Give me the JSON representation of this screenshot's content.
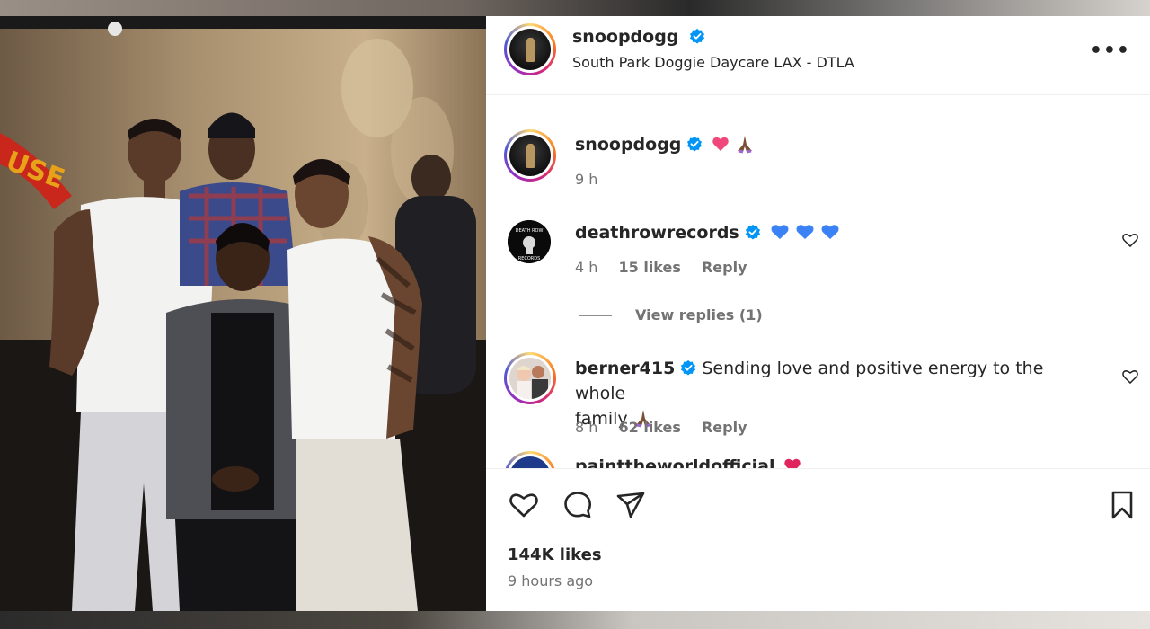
{
  "post": {
    "author": "snoopdogg",
    "location": "South Park Doggie Daycare LAX - DTLA",
    "more_label": "•••"
  },
  "comments": [
    {
      "user": "snoopdogg",
      "text": "",
      "time": "9 h"
    },
    {
      "user": "deathrowrecords",
      "text": "",
      "time": "4 h",
      "likes": "15 likes",
      "reply": "Reply"
    },
    {
      "user": "berner415",
      "text_line1": "Sending love and positive energy to the whole",
      "text_line2": "family",
      "time": "8 h",
      "likes": "62 likes",
      "reply": "Reply"
    },
    {
      "user": "painttheworldofficial"
    }
  ],
  "view_replies": "View replies (1)",
  "footer": {
    "likes": "144K likes",
    "time_ago": "9 hours ago"
  },
  "icons": {
    "verified": "verified-badge-icon",
    "heart": "heart-icon",
    "comment": "comment-icon",
    "share": "share-icon",
    "save": "bookmark-icon"
  },
  "colors": {
    "verified_blue": "#0095f6",
    "text": "#262626",
    "muted": "#737373"
  }
}
